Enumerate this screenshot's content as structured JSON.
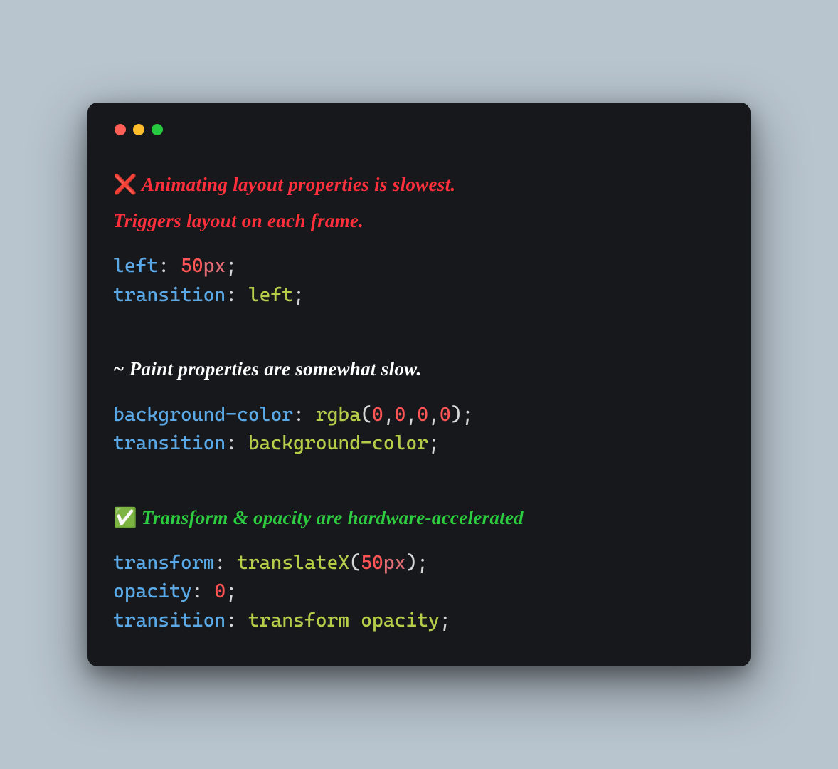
{
  "window": {
    "traffic_light_colors": {
      "red": "#ff5f56",
      "yellow": "#ffbd2e",
      "green": "#27c93f"
    }
  },
  "sections": {
    "bad": {
      "icon": "❌",
      "comment_line1": "Animating layout properties is slowest.",
      "comment_line2": "Triggers layout on each frame.",
      "code": {
        "l1": {
          "prop": "left",
          "colon_sp": ": ",
          "num": "50",
          "unit": "px",
          "semi": ";"
        },
        "l2": {
          "prop": "transition",
          "colon_sp": ": ",
          "val": "left",
          "semi": ";"
        }
      }
    },
    "mid": {
      "prefix": "~ ",
      "comment": "Paint properties are somewhat slow.",
      "code": {
        "l1": {
          "prop": "background-color",
          "colon_sp": ": ",
          "func": "rgba",
          "open": "(",
          "n0": "0",
          "c0": ",",
          "n1": "0",
          "c1": ",",
          "n2": "0",
          "c2": ",",
          "n3": "0",
          "close": ")",
          "semi": ";"
        },
        "l2": {
          "prop": "transition",
          "colon_sp": ": ",
          "val": "background-color",
          "semi": ";"
        }
      }
    },
    "good": {
      "icon": "✅",
      "comment": "Transform & opacity are hardware-accelerated",
      "code": {
        "l1": {
          "prop": "transform",
          "colon_sp": ": ",
          "func": "translateX",
          "open": "(",
          "num": "50",
          "unit": "px",
          "close": ")",
          "semi": ";"
        },
        "l2": {
          "prop": "opacity",
          "colon_sp": ": ",
          "num": "0",
          "semi": ";"
        },
        "l3": {
          "prop": "transition",
          "colon_sp": ": ",
          "val1": "transform",
          "sp": " ",
          "val2": "opacity",
          "semi": ";"
        }
      }
    }
  }
}
